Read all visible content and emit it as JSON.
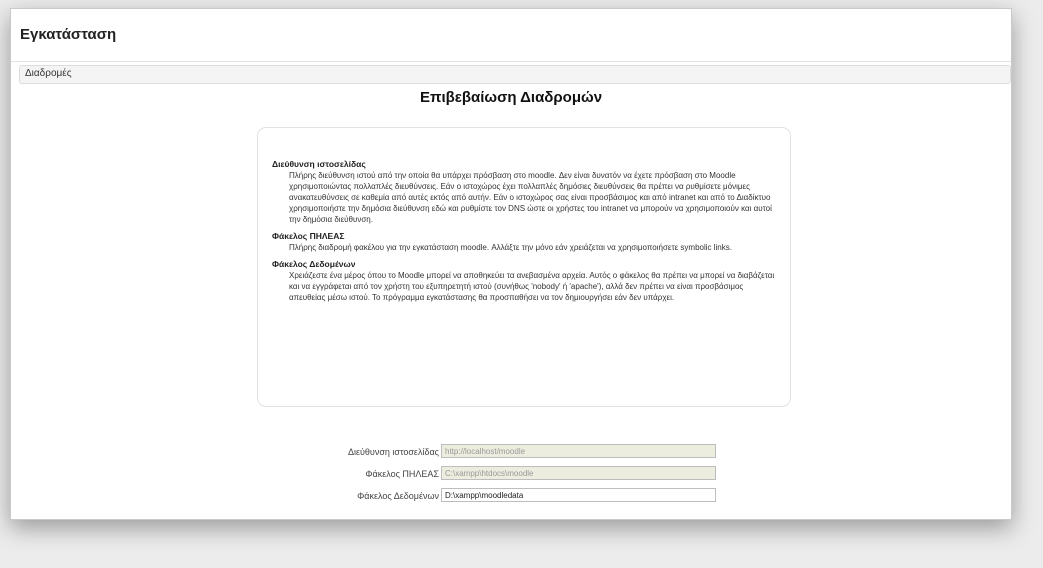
{
  "app_title": "Εγκατάσταση",
  "breadcrumb": "Διαδρομές",
  "page_title": "Επιβεβαίωση Διαδρομών",
  "info": [
    {
      "term": "Διεύθυνση ιστοσελίδας",
      "desc": "Πλήρης διεύθυνση ιστού από την οποία θα υπάρχει πρόσβαση στο moodle. Δεν είναι δυνατόν να έχετε πρόσβαση στο Moodle χρησιμοποιώντας πολλαπλές διευθύνσεις. Εάν ο ιστοχώρος έχει πολλαπλές δημόσιες διευθύνσεις θα πρέπει να ρυθμίσετε μόνιμες ανακατευθύνσεις σε καθεμία από αυτές εκτός από αυτήν. Εάν ο ιστοχώρος σας είναι προσβάσιμος και από intranet και από το Διαδίκτυο χρησιμοποιήστε την δημόσια διεύθυνση εδώ και ρυθμίστε τον DNS ώστε οι χρήστες του intranet να μπορούν να χρησιμοποιούν και αυτοί την δημόσια διεύθυνση."
    },
    {
      "term": "Φάκελος ΠΗΛΕΑΣ",
      "desc": "Πλήρης διαδρομή φακέλου για την εγκατάσταση moodle. Αλλάξτε την μόνο εάν χρειάζεται να χρησιμοποιήσετε symbolic links."
    },
    {
      "term": "Φάκελος Δεδομένων",
      "desc": "Χρειάζεστε ένα μέρος όπου το Moodle μπορεί να αποθηκεύει τα ανεβασμένα αρχεία. Αυτός ο φάκελος θα πρέπει να μπορεί να διαβάζεται και να εγγράφεται από τον χρήστη του εξυπηρετητή ιστού (συνήθως 'nobody' ή 'apache'), αλλά δεν πρέπει να είναι προσβάσιμος απευθείας μέσω ιστού. Το πρόγραμμα εγκατάστασης θα προσπαθήσει να τον δημιουργήσει εάν δεν υπάρχει."
    }
  ],
  "form": {
    "wwwroot_label": "Διεύθυνση ιστοσελίδας",
    "wwwroot_value": "http://localhost/moodle",
    "dirroot_label": "Φάκελος ΠΗΛΕΑΣ",
    "dirroot_value": "C:\\xampp\\htdocs\\moodle",
    "dataroot_label": "Φάκελος Δεδομένων",
    "dataroot_value": "D:\\xampp\\moodledata"
  }
}
